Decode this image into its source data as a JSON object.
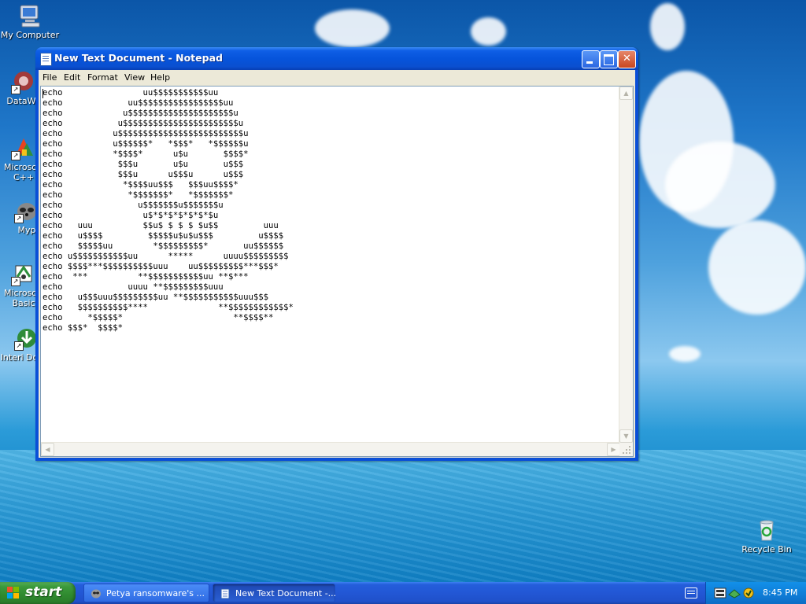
{
  "desktop": {
    "icons": [
      {
        "label": "My Computer"
      },
      {
        "label": "DataWa"
      },
      {
        "label": "Microsoft C++"
      },
      {
        "label": "Myp"
      },
      {
        "label": "Microsoft Basic"
      },
      {
        "label": "Interi Downl"
      },
      {
        "label": "Recycle Bin"
      }
    ]
  },
  "window": {
    "title": "New Text Document - Notepad",
    "menu": [
      "File",
      "Edit",
      "Format",
      "View",
      "Help"
    ],
    "content": "echo                uu$$$$$$$$$$$uu\necho             uu$$$$$$$$$$$$$$$$$uu\necho            u$$$$$$$$$$$$$$$$$$$$$u\necho           u$$$$$$$$$$$$$$$$$$$$$$$u\necho          u$$$$$$$$$$$$$$$$$$$$$$$$$u\necho          u$$$$$$*   *$$$*   *$$$$$$u\necho          *$$$$*      u$u       $$$$*\necho           $$$u       u$u       u$$$\necho           $$$u      u$$$u      u$$$\necho            *$$$$uu$$$   $$$uu$$$$*\necho             *$$$$$$$*   *$$$$$$$*\necho               u$$$$$$$u$$$$$$$u\necho                u$*$*$*$*$*$*$u\necho   uuu          $$u$ $ $ $ $u$$         uuu\necho   u$$$$         $$$$$u$u$u$$$         u$$$$\necho   $$$$$uu        *$$$$$$$$$*       uu$$$$$$\necho u$$$$$$$$$$$uu      *****      uuuu$$$$$$$$$\necho $$$$***$$$$$$$$$$uuu    uu$$$$$$$$$***$$$*\necho  ***          **$$$$$$$$$$$uu **$***\necho             uuuu **$$$$$$$$$uuu\necho   u$$$uuu$$$$$$$$$uu **$$$$$$$$$$$uuu$$$\necho   $$$$$$$$$$****              **$$$$$$$$$$$$*\necho     *$$$$$*                      **$$$$**\necho $$$*  $$$$*"
  },
  "taskbar": {
    "start_label": "start",
    "tasks": [
      {
        "label": "Petya ransomware's ..."
      },
      {
        "label": "New Text Document -..."
      }
    ],
    "clock": "8:45 PM"
  }
}
